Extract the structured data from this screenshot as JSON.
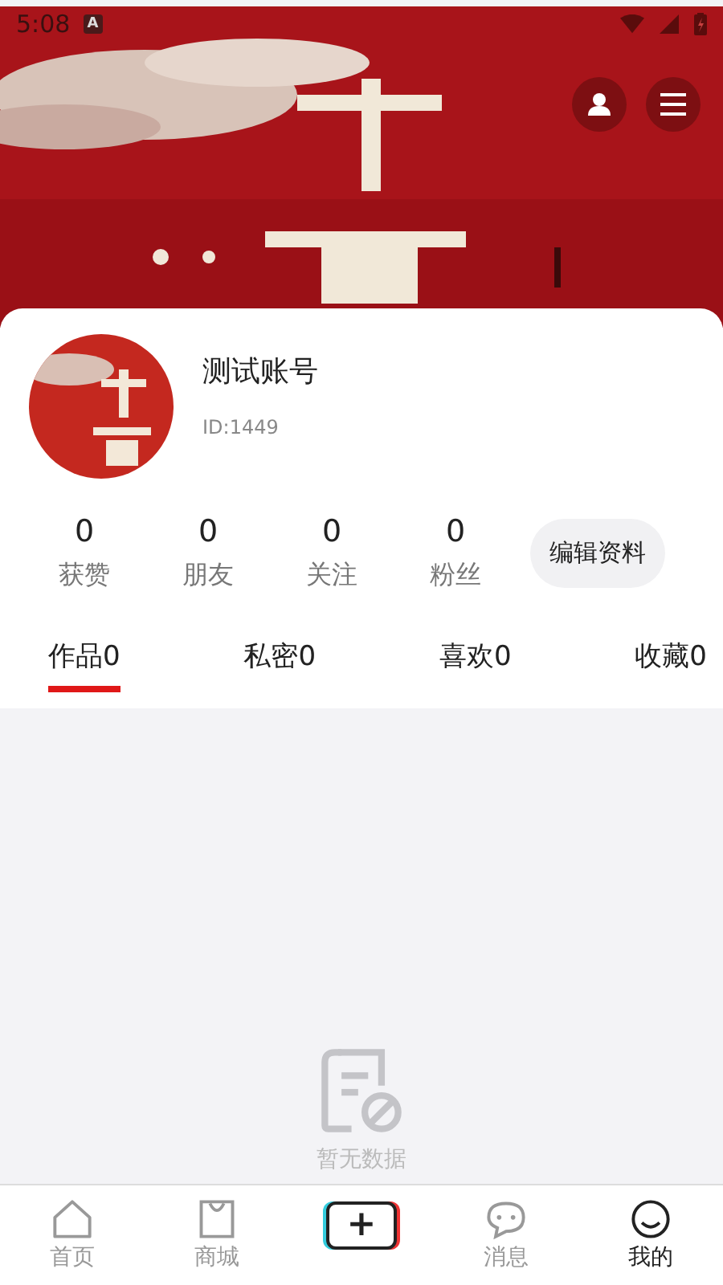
{
  "status_bar": {
    "time": "5:08",
    "notification": "A"
  },
  "profile": {
    "name": "测试账号",
    "id": "ID:1449"
  },
  "stats": [
    {
      "value": "0",
      "label": "获赞"
    },
    {
      "value": "0",
      "label": "朋友"
    },
    {
      "value": "0",
      "label": "关注"
    },
    {
      "value": "0",
      "label": "粉丝"
    }
  ],
  "edit_button": "编辑资料",
  "tabs": [
    {
      "label": "作品0",
      "selected": true
    },
    {
      "label": "私密0",
      "selected": false
    },
    {
      "label": "喜欢0",
      "selected": false
    },
    {
      "label": "收藏0",
      "selected": false
    }
  ],
  "empty_state": "暂无数据",
  "bottom_nav": [
    {
      "kind": "home",
      "label": "首页",
      "selected": false
    },
    {
      "kind": "shop",
      "label": "商城",
      "selected": false
    },
    {
      "kind": "add",
      "label": "+"
    },
    {
      "kind": "message",
      "label": "消息",
      "selected": false
    },
    {
      "kind": "me",
      "label": "我的",
      "selected": true
    }
  ]
}
